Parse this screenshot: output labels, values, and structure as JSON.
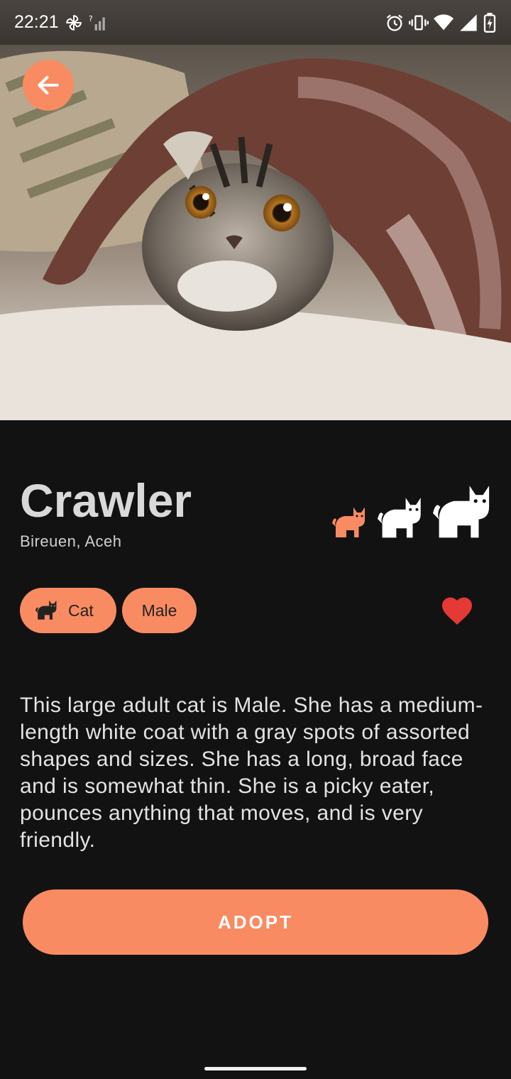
{
  "status_bar": {
    "time": "22:21",
    "left_icons": [
      "pinwheel-icon",
      "signal-unknown-icon"
    ],
    "right_icons": [
      "alarm-icon",
      "vibrate-icon",
      "wifi-icon",
      "cell-signal-icon",
      "battery-charging-icon"
    ]
  },
  "hero": {
    "image": "cat-under-blanket-photo"
  },
  "nav": {
    "back_icon": "arrow-left-icon"
  },
  "pet": {
    "name": "Crawler",
    "location": "Bireuen, Aceh",
    "size_icons": [
      "cat-small-icon",
      "cat-medium-icon",
      "cat-large-icon"
    ],
    "selected_size_index": 0,
    "chips": [
      {
        "icon": "cat-icon",
        "label": "Cat"
      },
      {
        "label": "Male"
      }
    ],
    "favorite_icon": "heart-icon",
    "description": "This large adult cat is Male.  She has a medium-length white coat with a gray spots of assorted shapes and sizes.  She has a long, broad face and is somewhat thin.  She is a picky eater, pounces anything that moves, and is very friendly."
  },
  "actions": {
    "adopt_label": "ADOPT"
  },
  "colors": {
    "accent": "#f98b63",
    "background": "#121212",
    "heart": "#e53935"
  }
}
